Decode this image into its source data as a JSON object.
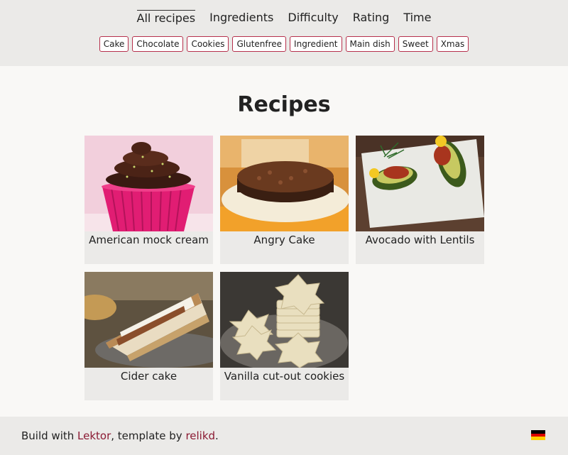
{
  "nav": {
    "tabs": [
      {
        "label": "All recipes",
        "active": true
      },
      {
        "label": "Ingredients"
      },
      {
        "label": "Difficulty"
      },
      {
        "label": "Rating"
      },
      {
        "label": "Time"
      }
    ]
  },
  "tags": [
    "Cake",
    "Chocolate",
    "Cookies",
    "Glutenfree",
    "Ingredient",
    "Main dish",
    "Sweet",
    "Xmas"
  ],
  "main": {
    "title": "Recipes",
    "recipes": [
      {
        "label": "American mock cream"
      },
      {
        "label": "Angry Cake"
      },
      {
        "label": "Avocado with Lentils"
      },
      {
        "label": "Cider cake"
      },
      {
        "label": "Vanilla cut-out cookies"
      }
    ]
  },
  "footer": {
    "prefix": "Build with ",
    "link1": "Lektor",
    "middle": ", template by ",
    "link2": "relikd",
    "suffix": ".",
    "flag_icon": "german-flag-icon",
    "link_color": "#8b1a33",
    "tag_border_color": "#b6304c"
  }
}
